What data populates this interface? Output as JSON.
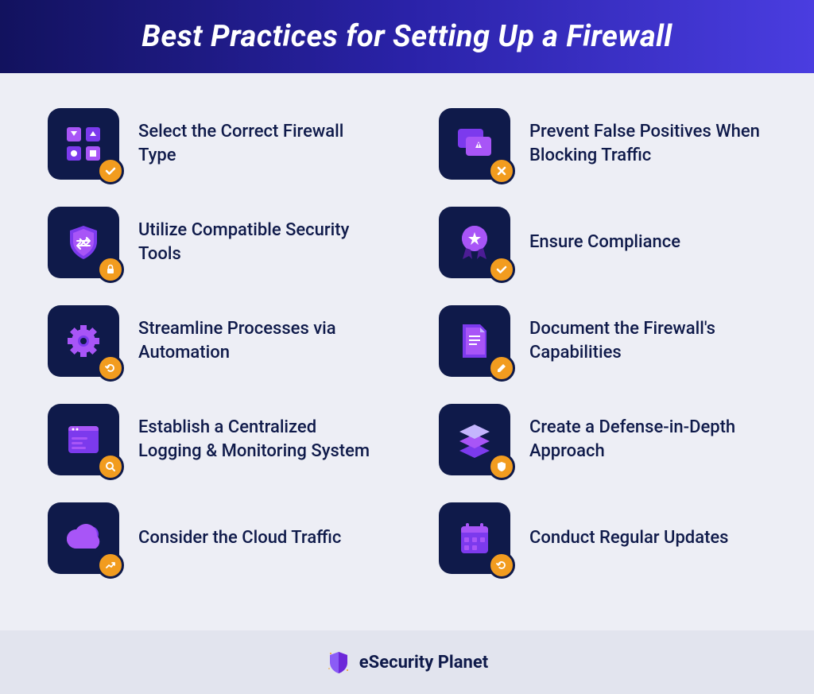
{
  "header": {
    "title": "Best Practices for Setting Up a Firewall"
  },
  "items": [
    {
      "label": "Select the Correct Firewall Type"
    },
    {
      "label": "Prevent False Positives When Blocking Traffic"
    },
    {
      "label": "Utilize Compatible Security Tools"
    },
    {
      "label": "Ensure Compliance"
    },
    {
      "label": "Streamline Processes via Automation"
    },
    {
      "label": "Document the Firewall's Capabilities"
    },
    {
      "label": "Establish a Centralized Logging & Monitoring System"
    },
    {
      "label": "Create a Defense-in-Depth Approach"
    },
    {
      "label": "Consider the Cloud Traffic"
    },
    {
      "label": "Conduct Regular Updates"
    }
  ],
  "footer": {
    "brand": "eSecurity Planet"
  },
  "colors": {
    "header_gradient_start": "#12125e",
    "header_gradient_end": "#4a3de0",
    "icon_box": "#0f1a4a",
    "icon_primary": "#a855f7",
    "icon_secondary": "#7c3aed",
    "badge": "#f29c1f",
    "background": "#edeef5",
    "footer_bg": "#e2e4ee"
  }
}
